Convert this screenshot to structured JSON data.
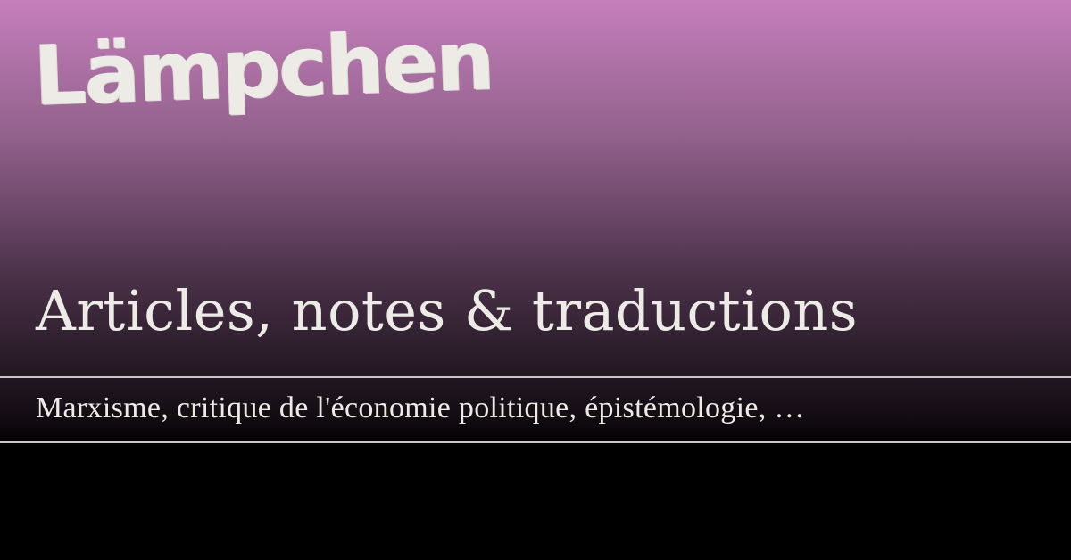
{
  "brand": {
    "logo_text": "Lämpchen"
  },
  "hero": {
    "headline": "Articles, notes & traductions",
    "tagline": "Marxisme, critique de l'économie politique, épistémologie, …"
  },
  "colors": {
    "gradient_top": "#c47fbb",
    "gradient_bottom": "#000000",
    "text": "#ecebe6",
    "rule": "#c9c6c8"
  }
}
